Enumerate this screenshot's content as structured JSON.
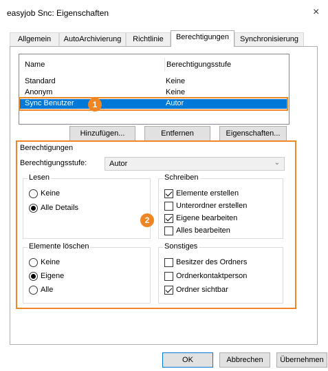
{
  "window": {
    "title": "easyjob Snc: Eigenschaften",
    "close_icon": "×"
  },
  "tabs": [
    {
      "label": "Allgemein"
    },
    {
      "label": "AutoArchivierung"
    },
    {
      "label": "Richtlinie"
    },
    {
      "label": "Berechtigungen",
      "active": true
    },
    {
      "label": "Synchronisierung"
    }
  ],
  "list": {
    "headers": [
      "Name",
      "Berechtigungsstufe"
    ],
    "rows": [
      {
        "name": "Standard",
        "level": "Keine"
      },
      {
        "name": "Anonym",
        "level": "Keine"
      },
      {
        "name": "Sync Benutzer",
        "level": "Autor",
        "selected": true
      }
    ]
  },
  "list_buttons": {
    "add": "Hinzufügen...",
    "remove": "Entfernen",
    "properties": "Eigenschaften..."
  },
  "badges": {
    "one": "1",
    "two": "2"
  },
  "permissions": {
    "title": "Berechtigungen",
    "level_label": "Berechtigungsstufe:",
    "level_value": "Autor",
    "read": {
      "title": "Lesen",
      "options": [
        "Keine",
        "Alle Details"
      ],
      "selected_index": 1
    },
    "write": {
      "title": "Schreiben",
      "options": [
        {
          "label": "Elemente erstellen",
          "checked": true
        },
        {
          "label": "Unterordner erstellen",
          "checked": false
        },
        {
          "label": "Eigene bearbeiten",
          "checked": true
        },
        {
          "label": "Alles bearbeiten",
          "checked": false
        }
      ]
    },
    "delete": {
      "title": "Elemente löschen",
      "options": [
        "Keine",
        "Eigene",
        "Alle"
      ],
      "selected_index": 1
    },
    "other": {
      "title": "Sonstiges",
      "options": [
        {
          "label": "Besitzer des Ordners",
          "checked": false
        },
        {
          "label": "Ordnerkontaktperson",
          "checked": false
        },
        {
          "label": "Ordner sichtbar",
          "checked": true
        }
      ]
    }
  },
  "footer": {
    "ok": "OK",
    "cancel": "Abbrechen",
    "apply": "Übernehmen"
  },
  "colors": {
    "accent_orange": "#f08523",
    "selection_blue": "#0078d7"
  }
}
